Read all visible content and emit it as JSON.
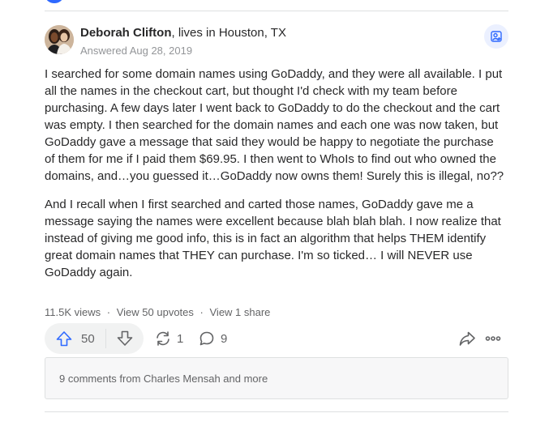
{
  "answer": {
    "author": {
      "name": "Deborah Clifton",
      "credential": ", lives in Houston, TX"
    },
    "date": "Answered Aug 28, 2019",
    "paragraphs": [
      "I searched for some domain names using GoDaddy, and they were all available. I put all the names in the checkout cart, but thought I'd check with my team before purchasing. A few days later I went back to GoDaddy to do the checkout and the cart was empty. I then searched for the domain names and each one was now taken, but GoDaddy gave a message that said they would be happy to negotiate the purchase of them for me if I paid them $69.95. I then went to WhoIs to find out who owned the domains, and…you guessed it…GoDaddy now owns them! Surely this is illegal, no??",
      "And I recall when I first searched and carted those names, GoDaddy gave me a message saying the names were excellent because blah blah blah. I now realize that instead of giving me good info, this is in fact an algorithm that helps THEM identify great domain names that THEY can purchase. I'm so ticked… I will NEVER use GoDaddy again."
    ],
    "stats": {
      "views": "11.5K views",
      "separator": "·",
      "upvotes": "View 50 upvotes",
      "shares": "View 1 share"
    },
    "actions": {
      "upvote_count": "50",
      "share_count": "1",
      "comment_count": "9"
    },
    "comments_summary": "9 comments from Charles Mensah and more"
  },
  "icons": {
    "follow": "add-person-icon",
    "upvote": "upvote-arrow-icon",
    "downvote": "downvote-arrow-icon",
    "share": "reshare-icon",
    "comment": "comment-bubble-icon",
    "forward": "forward-share-icon",
    "more": "more-dots-icon"
  },
  "colors": {
    "accent": "#2e69ff",
    "text": "#282829",
    "muted": "#636466"
  }
}
